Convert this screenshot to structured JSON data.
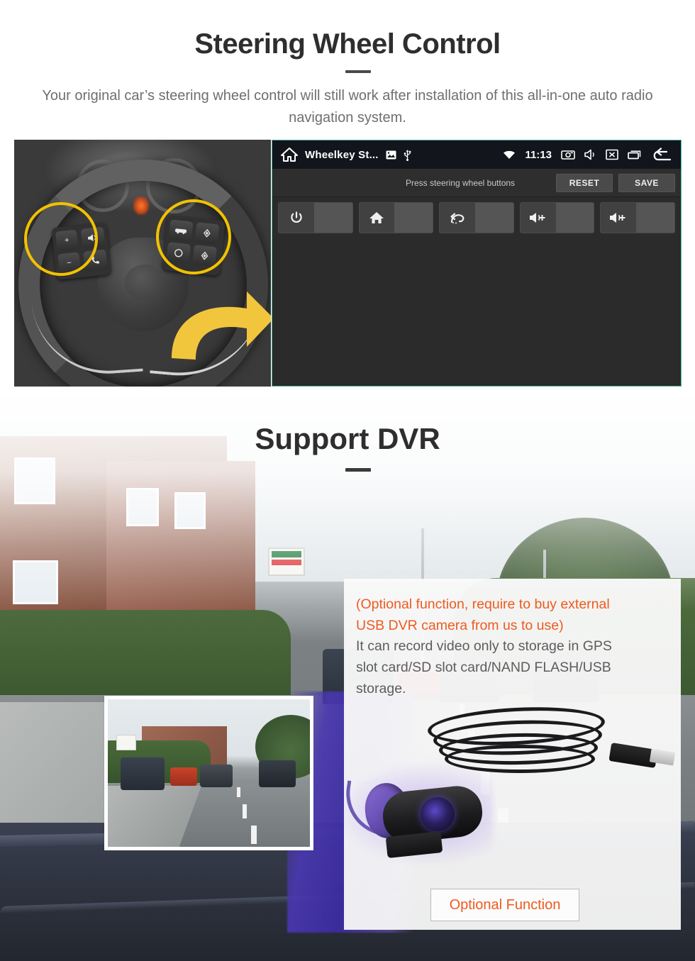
{
  "section1": {
    "title": "Steering Wheel Control",
    "subtitle": "Your original car’s steering wheel control will still work after installation of this all-in-one auto radio navigation system.",
    "photo_alt": "steering-wheel-photo",
    "screen": {
      "statusbar": {
        "home_icon": "home-icon",
        "app_title": "Wheelkey St...",
        "gallery_icon": "image-icon",
        "usb_icon": "usb-icon",
        "wifi_icon": "wifi-icon",
        "time": "11:13",
        "screenshot_icon": "camera-icon",
        "mute_icon": "speaker-mute-icon",
        "screenoff_icon": "screen-off-icon",
        "recents_icon": "recents-icon",
        "back_icon": "back-icon"
      },
      "actionbar": {
        "hint": "Press steering wheel buttons",
        "reset_label": "RESET",
        "save_label": "SAVE"
      },
      "keys": [
        {
          "icon": "power-icon",
          "label": "",
          "value": ""
        },
        {
          "icon": "home-icon",
          "label": "",
          "value": ""
        },
        {
          "icon": "back-icon",
          "label": "",
          "value": ""
        },
        {
          "icon": "volume-up-icon",
          "label": "",
          "value": ""
        },
        {
          "icon": "volume-up-icon",
          "label": "",
          "value": ""
        }
      ],
      "accent_color": "#49b6a0",
      "statusbar_color": "#13151c",
      "background_color": "#2b2b2b"
    }
  },
  "section2": {
    "title": "Support DVR",
    "info": {
      "highlight_line1": "(Optional function, require to buy external",
      "highlight_line2": "USB DVR camera from us to use)",
      "body_line1": "It can record video only to storage in GPS",
      "body_line2": "slot card/SD slot card/NAND FLASH/USB",
      "body_line3": "storage."
    },
    "optional_button_label": "Optional Function",
    "thumbnail_alt": "dvr-recording-preview",
    "product_alt": "usb-dvr-camera",
    "highlight_color": "#ef5a1f",
    "body_text_color": "#5c5c5c"
  }
}
